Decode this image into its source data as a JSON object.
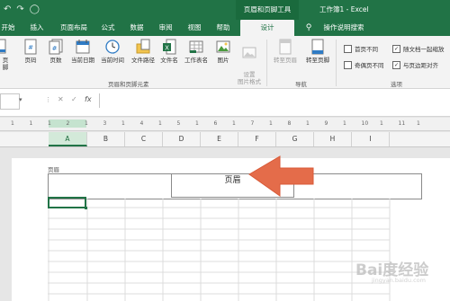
{
  "title_bar": {
    "contextual_tab": "页眉和页脚工具",
    "window_title": "工作簿1  -  Excel"
  },
  "tabs": [
    {
      "label": "开始"
    },
    {
      "label": "插入"
    },
    {
      "label": "页面布局"
    },
    {
      "label": "公式"
    },
    {
      "label": "数据"
    },
    {
      "label": "审阅"
    },
    {
      "label": "视图"
    },
    {
      "label": "帮助"
    },
    {
      "label": "设计"
    },
    {
      "label": "操作说明搜索"
    }
  ],
  "ribbon": {
    "partial_left": "页脚",
    "elements": [
      {
        "label": "页码"
      },
      {
        "label": "页数"
      },
      {
        "label": "当前日期"
      },
      {
        "label": "当前时间"
      },
      {
        "label": "文件路径"
      },
      {
        "label": "文件名"
      },
      {
        "label": "工作表名"
      },
      {
        "label": "图片"
      },
      {
        "label": "设置\n图片格式"
      }
    ],
    "group_elements_label": "页眉和页脚元素",
    "nav": [
      {
        "label": "转至页眉"
      },
      {
        "label": "转至页脚"
      }
    ],
    "group_nav_label": "导航",
    "options": [
      {
        "label": "首页不同",
        "checked": false
      },
      {
        "label": "奇偶页不同",
        "checked": false
      },
      {
        "label": "随文档一起缩放",
        "checked": true
      },
      {
        "label": "与页边距对齐",
        "checked": true
      }
    ],
    "group_options_label": "选项"
  },
  "formula_bar": {
    "fx": "fx",
    "value": ""
  },
  "ruler": {
    "numbers": [
      "1",
      "1",
      "1",
      "2",
      "1",
      "3",
      "1",
      "4",
      "1",
      "5",
      "1",
      "6",
      "1",
      "7",
      "1",
      "8",
      "1",
      "9",
      "1",
      "10",
      "1",
      "11",
      "1"
    ]
  },
  "columns": [
    "A",
    "B",
    "C",
    "D",
    "E",
    "F",
    "G",
    "H",
    "I"
  ],
  "page": {
    "header_label": "页眉",
    "header_center_text": "页眉"
  },
  "watermark": {
    "text": "Bai度经验",
    "sub": "jingyan.baidu.com"
  },
  "colors": {
    "accent": "#217346",
    "arrow": "#e46c4a"
  }
}
